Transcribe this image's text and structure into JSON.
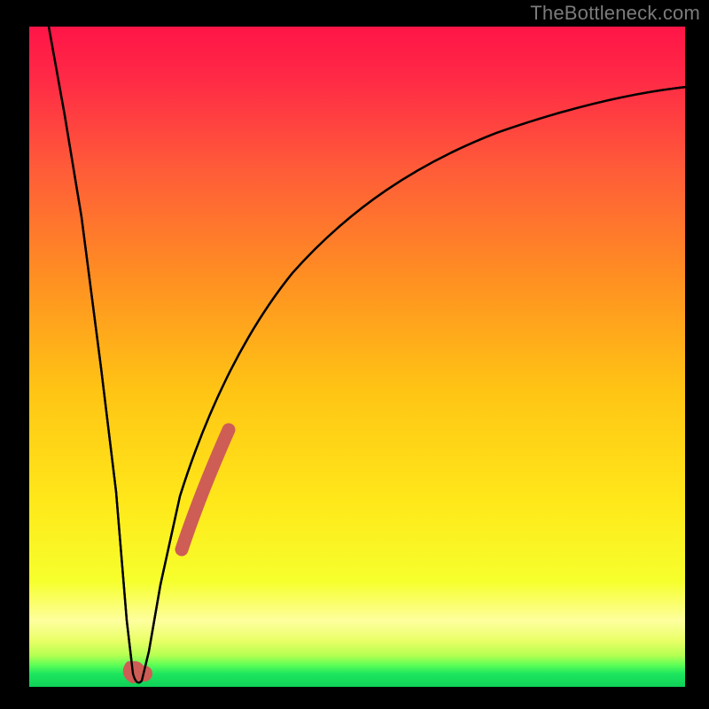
{
  "watermark": "TheBottleneck.com",
  "colors": {
    "frame": "#000000",
    "curve": "#000000",
    "markers": "#ce5d55",
    "gradient_top": "#ff1846",
    "gradient_mid1": "#ff9a1a",
    "gradient_mid2": "#ffe81a",
    "gradient_mid3": "#f7ff2e",
    "gradient_band": "#feffa0",
    "gradient_green": "#1de65e"
  },
  "chart_data": {
    "type": "line",
    "title": "",
    "xlabel": "",
    "ylabel": "",
    "xlim": [
      0,
      100
    ],
    "ylim": [
      0,
      100
    ],
    "series": [
      {
        "name": "bottleneck-curve",
        "x": [
          3,
          6,
          9,
          12,
          14,
          15.5,
          17,
          19,
          22,
          26,
          32,
          40,
          50,
          62,
          76,
          90,
          100
        ],
        "y": [
          100,
          78,
          55,
          31,
          10,
          1,
          10,
          28,
          45,
          58,
          68,
          76,
          82,
          86.5,
          89.5,
          91.3,
          92
        ]
      }
    ],
    "markers": [
      {
        "name": "min-marker",
        "x": 15.5,
        "y": 2.3,
        "r": 2.0
      },
      {
        "name": "min-marker-2",
        "x": 16.7,
        "y": 2.2,
        "r": 1.6
      },
      {
        "name": "slope-band",
        "type": "segment",
        "x0": 22.2,
        "y0": 20.0,
        "x1": 28.0,
        "y1": 41.0,
        "w": 1.9
      }
    ],
    "green_zone_y": [
      0,
      3.5
    ]
  }
}
